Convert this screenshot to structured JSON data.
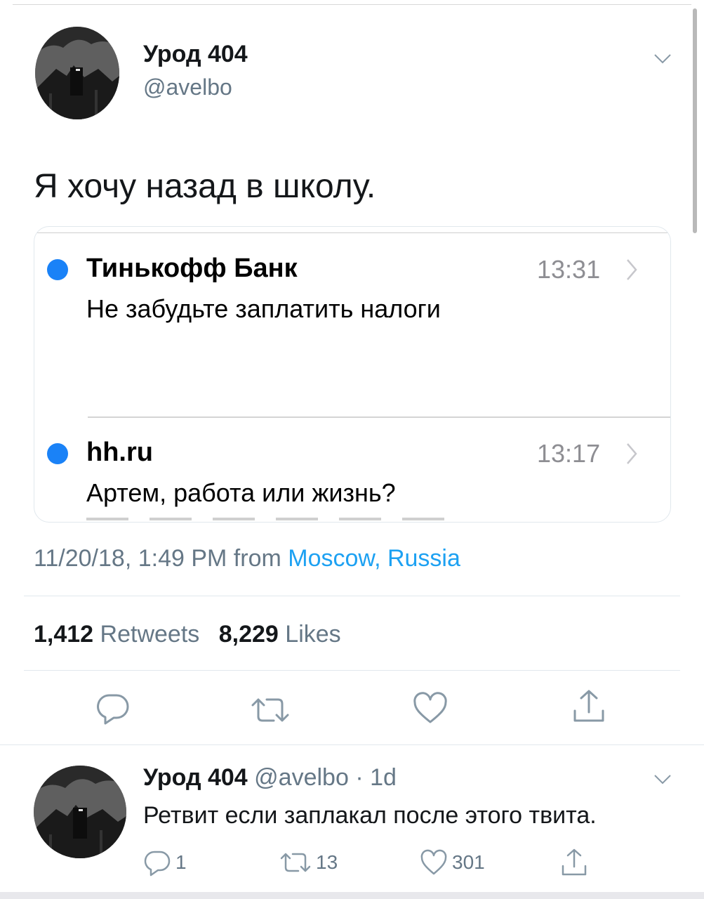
{
  "tweet": {
    "author_name": "Урод 404",
    "author_handle": "@avelbo",
    "text": "Я хочу назад в школу.",
    "timestamp": "11/20/18, 1:49 PM",
    "from_label": "from",
    "location": "Moscow, Russia",
    "retweets_count": "1,412",
    "retweets_label": "Retweets",
    "likes_count": "8,229",
    "likes_label": "Likes"
  },
  "embedded_notifications": [
    {
      "sender": "Тинькофф Банк",
      "time": "13:31",
      "message": "Не забудьте заплатить налоги"
    },
    {
      "sender": "hh.ru",
      "time": "13:17",
      "message": "Артем, работа или жизнь?"
    }
  ],
  "reply": {
    "author_name": "Урод 404",
    "author_handle": "@avelbo",
    "age": "· 1d",
    "text": "Ретвит если заплакал после этого твита.",
    "reply_count": "1",
    "retweet_count": "13",
    "like_count": "301"
  },
  "colors": {
    "link": "#1da1f2",
    "secondary_text": "#657786",
    "unread_dot": "#1a82f7"
  },
  "icons": [
    "chevron-down-icon",
    "reply-icon",
    "retweet-icon",
    "heart-icon",
    "share-icon",
    "chevron-right-icon"
  ]
}
